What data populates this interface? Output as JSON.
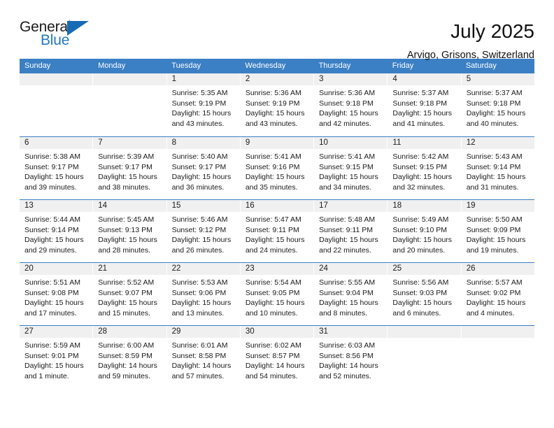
{
  "brand": {
    "name_top": "General",
    "name_bottom": "Blue",
    "accent_color": "#2079c4",
    "triangle_color": "#176bb5"
  },
  "header": {
    "title": "July 2025",
    "subtitle": "Arvigo, Grisons, Switzerland"
  },
  "calendar": {
    "header_bg": "#3b7fc4",
    "day_band_bg": "#f0f0f0",
    "weekdays": [
      "Sunday",
      "Monday",
      "Tuesday",
      "Wednesday",
      "Thursday",
      "Friday",
      "Saturday"
    ],
    "weeks": [
      [
        {
          "day": "",
          "sunrise": "",
          "sunset": "",
          "daylight1": "",
          "daylight2": ""
        },
        {
          "day": "",
          "sunrise": "",
          "sunset": "",
          "daylight1": "",
          "daylight2": ""
        },
        {
          "day": "1",
          "sunrise": "Sunrise: 5:35 AM",
          "sunset": "Sunset: 9:19 PM",
          "daylight1": "Daylight: 15 hours",
          "daylight2": "and 43 minutes."
        },
        {
          "day": "2",
          "sunrise": "Sunrise: 5:36 AM",
          "sunset": "Sunset: 9:19 PM",
          "daylight1": "Daylight: 15 hours",
          "daylight2": "and 43 minutes."
        },
        {
          "day": "3",
          "sunrise": "Sunrise: 5:36 AM",
          "sunset": "Sunset: 9:18 PM",
          "daylight1": "Daylight: 15 hours",
          "daylight2": "and 42 minutes."
        },
        {
          "day": "4",
          "sunrise": "Sunrise: 5:37 AM",
          "sunset": "Sunset: 9:18 PM",
          "daylight1": "Daylight: 15 hours",
          "daylight2": "and 41 minutes."
        },
        {
          "day": "5",
          "sunrise": "Sunrise: 5:37 AM",
          "sunset": "Sunset: 9:18 PM",
          "daylight1": "Daylight: 15 hours",
          "daylight2": "and 40 minutes."
        }
      ],
      [
        {
          "day": "6",
          "sunrise": "Sunrise: 5:38 AM",
          "sunset": "Sunset: 9:17 PM",
          "daylight1": "Daylight: 15 hours",
          "daylight2": "and 39 minutes."
        },
        {
          "day": "7",
          "sunrise": "Sunrise: 5:39 AM",
          "sunset": "Sunset: 9:17 PM",
          "daylight1": "Daylight: 15 hours",
          "daylight2": "and 38 minutes."
        },
        {
          "day": "8",
          "sunrise": "Sunrise: 5:40 AM",
          "sunset": "Sunset: 9:17 PM",
          "daylight1": "Daylight: 15 hours",
          "daylight2": "and 36 minutes."
        },
        {
          "day": "9",
          "sunrise": "Sunrise: 5:41 AM",
          "sunset": "Sunset: 9:16 PM",
          "daylight1": "Daylight: 15 hours",
          "daylight2": "and 35 minutes."
        },
        {
          "day": "10",
          "sunrise": "Sunrise: 5:41 AM",
          "sunset": "Sunset: 9:15 PM",
          "daylight1": "Daylight: 15 hours",
          "daylight2": "and 34 minutes."
        },
        {
          "day": "11",
          "sunrise": "Sunrise: 5:42 AM",
          "sunset": "Sunset: 9:15 PM",
          "daylight1": "Daylight: 15 hours",
          "daylight2": "and 32 minutes."
        },
        {
          "day": "12",
          "sunrise": "Sunrise: 5:43 AM",
          "sunset": "Sunset: 9:14 PM",
          "daylight1": "Daylight: 15 hours",
          "daylight2": "and 31 minutes."
        }
      ],
      [
        {
          "day": "13",
          "sunrise": "Sunrise: 5:44 AM",
          "sunset": "Sunset: 9:14 PM",
          "daylight1": "Daylight: 15 hours",
          "daylight2": "and 29 minutes."
        },
        {
          "day": "14",
          "sunrise": "Sunrise: 5:45 AM",
          "sunset": "Sunset: 9:13 PM",
          "daylight1": "Daylight: 15 hours",
          "daylight2": "and 28 minutes."
        },
        {
          "day": "15",
          "sunrise": "Sunrise: 5:46 AM",
          "sunset": "Sunset: 9:12 PM",
          "daylight1": "Daylight: 15 hours",
          "daylight2": "and 26 minutes."
        },
        {
          "day": "16",
          "sunrise": "Sunrise: 5:47 AM",
          "sunset": "Sunset: 9:11 PM",
          "daylight1": "Daylight: 15 hours",
          "daylight2": "and 24 minutes."
        },
        {
          "day": "17",
          "sunrise": "Sunrise: 5:48 AM",
          "sunset": "Sunset: 9:11 PM",
          "daylight1": "Daylight: 15 hours",
          "daylight2": "and 22 minutes."
        },
        {
          "day": "18",
          "sunrise": "Sunrise: 5:49 AM",
          "sunset": "Sunset: 9:10 PM",
          "daylight1": "Daylight: 15 hours",
          "daylight2": "and 20 minutes."
        },
        {
          "day": "19",
          "sunrise": "Sunrise: 5:50 AM",
          "sunset": "Sunset: 9:09 PM",
          "daylight1": "Daylight: 15 hours",
          "daylight2": "and 19 minutes."
        }
      ],
      [
        {
          "day": "20",
          "sunrise": "Sunrise: 5:51 AM",
          "sunset": "Sunset: 9:08 PM",
          "daylight1": "Daylight: 15 hours",
          "daylight2": "and 17 minutes."
        },
        {
          "day": "21",
          "sunrise": "Sunrise: 5:52 AM",
          "sunset": "Sunset: 9:07 PM",
          "daylight1": "Daylight: 15 hours",
          "daylight2": "and 15 minutes."
        },
        {
          "day": "22",
          "sunrise": "Sunrise: 5:53 AM",
          "sunset": "Sunset: 9:06 PM",
          "daylight1": "Daylight: 15 hours",
          "daylight2": "and 13 minutes."
        },
        {
          "day": "23",
          "sunrise": "Sunrise: 5:54 AM",
          "sunset": "Sunset: 9:05 PM",
          "daylight1": "Daylight: 15 hours",
          "daylight2": "and 10 minutes."
        },
        {
          "day": "24",
          "sunrise": "Sunrise: 5:55 AM",
          "sunset": "Sunset: 9:04 PM",
          "daylight1": "Daylight: 15 hours",
          "daylight2": "and 8 minutes."
        },
        {
          "day": "25",
          "sunrise": "Sunrise: 5:56 AM",
          "sunset": "Sunset: 9:03 PM",
          "daylight1": "Daylight: 15 hours",
          "daylight2": "and 6 minutes."
        },
        {
          "day": "26",
          "sunrise": "Sunrise: 5:57 AM",
          "sunset": "Sunset: 9:02 PM",
          "daylight1": "Daylight: 15 hours",
          "daylight2": "and 4 minutes."
        }
      ],
      [
        {
          "day": "27",
          "sunrise": "Sunrise: 5:59 AM",
          "sunset": "Sunset: 9:01 PM",
          "daylight1": "Daylight: 15 hours",
          "daylight2": "and 1 minute."
        },
        {
          "day": "28",
          "sunrise": "Sunrise: 6:00 AM",
          "sunset": "Sunset: 8:59 PM",
          "daylight1": "Daylight: 14 hours",
          "daylight2": "and 59 minutes."
        },
        {
          "day": "29",
          "sunrise": "Sunrise: 6:01 AM",
          "sunset": "Sunset: 8:58 PM",
          "daylight1": "Daylight: 14 hours",
          "daylight2": "and 57 minutes."
        },
        {
          "day": "30",
          "sunrise": "Sunrise: 6:02 AM",
          "sunset": "Sunset: 8:57 PM",
          "daylight1": "Daylight: 14 hours",
          "daylight2": "and 54 minutes."
        },
        {
          "day": "31",
          "sunrise": "Sunrise: 6:03 AM",
          "sunset": "Sunset: 8:56 PM",
          "daylight1": "Daylight: 14 hours",
          "daylight2": "and 52 minutes."
        },
        {
          "day": "",
          "sunrise": "",
          "sunset": "",
          "daylight1": "",
          "daylight2": ""
        },
        {
          "day": "",
          "sunrise": "",
          "sunset": "",
          "daylight1": "",
          "daylight2": ""
        }
      ]
    ]
  }
}
